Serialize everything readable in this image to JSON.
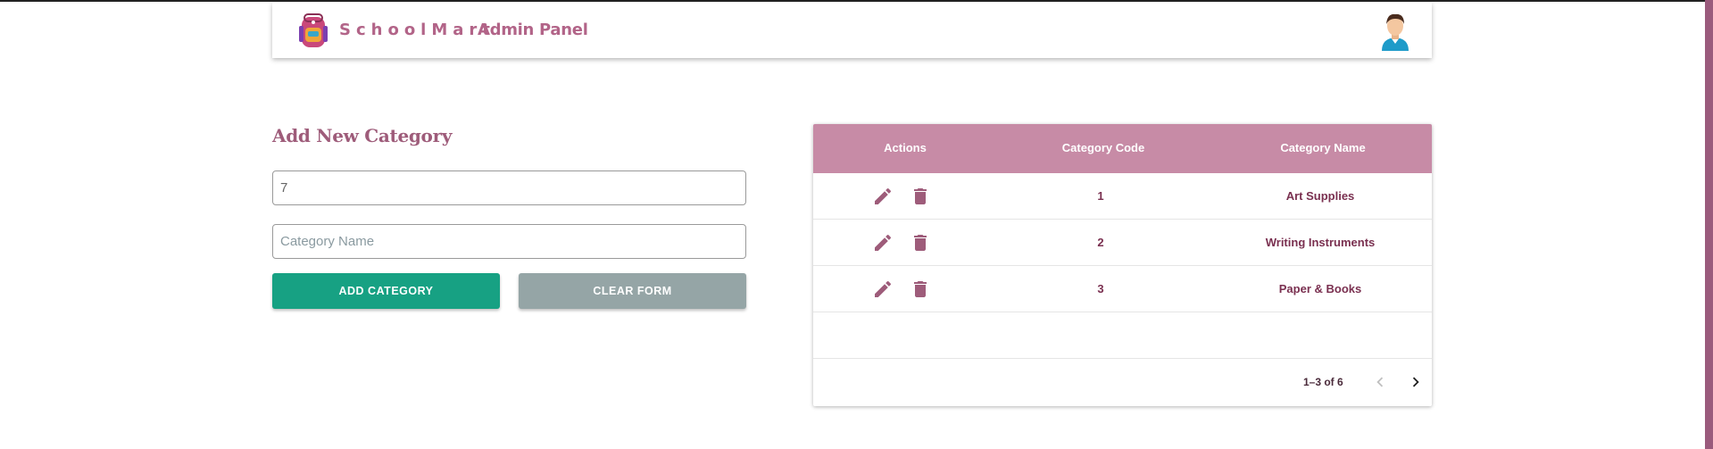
{
  "header": {
    "brand": "SchoolMart",
    "panel_title": "Admin Panel"
  },
  "form": {
    "title": "Add New Category",
    "code_value": "7",
    "name_placeholder": "Category Name",
    "add_label": "ADD CATEGORY",
    "clear_label": "CLEAR FORM"
  },
  "table": {
    "columns": [
      "Actions",
      "Category Code",
      "Category Name"
    ],
    "rows": [
      {
        "code": "1",
        "name": "Art Supplies"
      },
      {
        "code": "2",
        "name": "Writing Instruments"
      },
      {
        "code": "3",
        "name": "Paper & Books"
      }
    ],
    "pagination": "1–3 of 6"
  },
  "colors": {
    "brand": "#b26488",
    "header_row": "#c78ba6",
    "add_button": "#17a183",
    "clear_button": "#95a5a6",
    "action_icon": "#9e5c7a"
  },
  "icons": [
    "backpack-logo-icon",
    "user-avatar-icon",
    "edit-pencil-icon",
    "delete-trash-icon",
    "chevron-left-icon",
    "chevron-right-icon"
  ]
}
